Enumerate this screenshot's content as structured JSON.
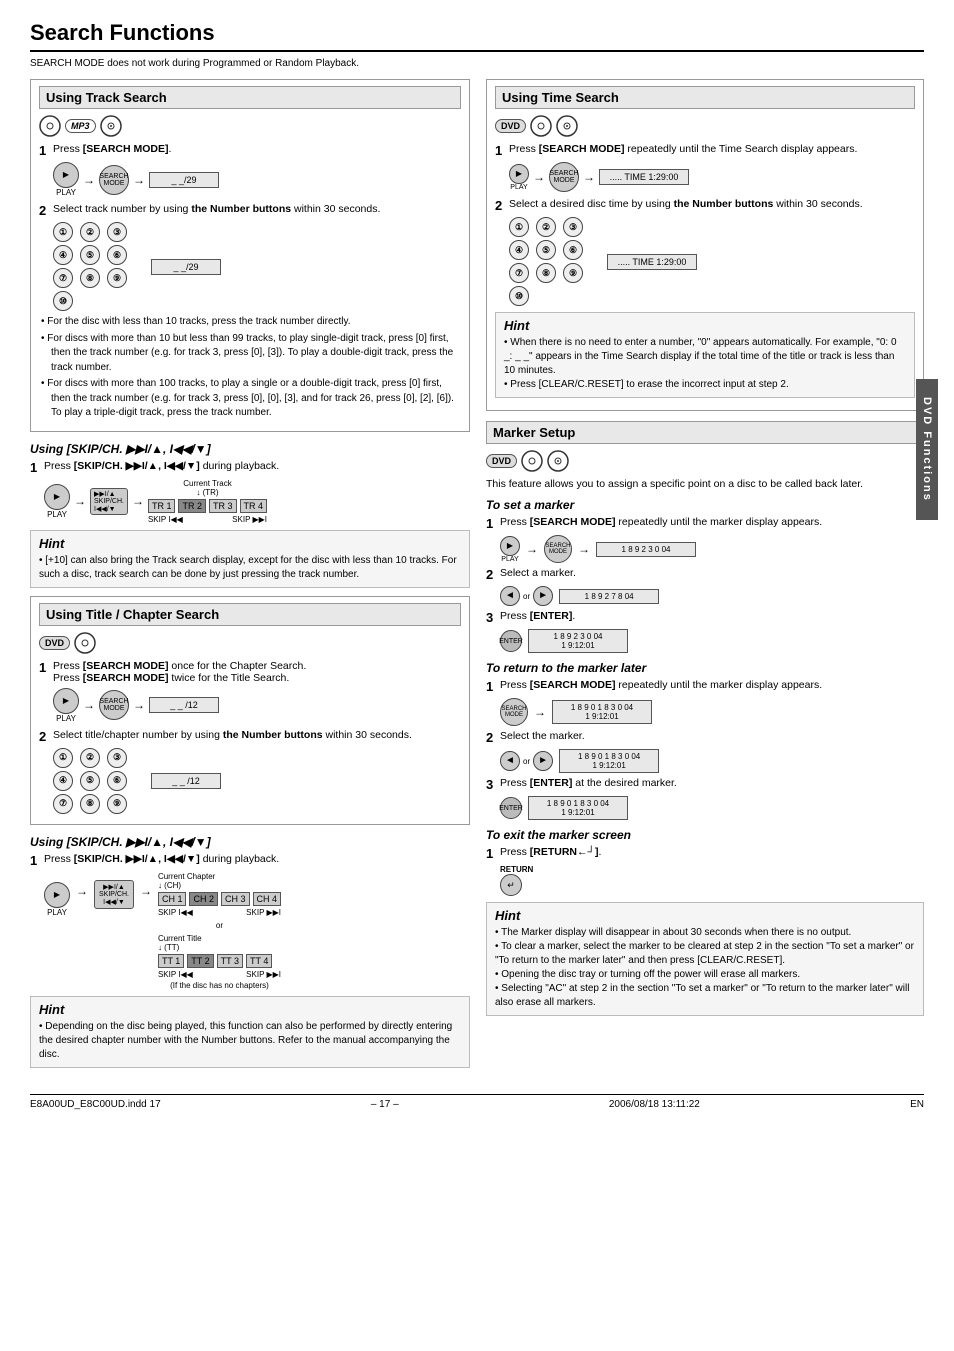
{
  "page": {
    "title": "Search Functions",
    "subtitle": "SEARCH MODE does not work during Programmed or Random Playback.",
    "footer_center": "– 17 –",
    "footer_right": "EN",
    "footer_file": "E8A00UD_E8C00UD.indd  17",
    "footer_date": "2006/08/18  13:11:22"
  },
  "left": {
    "track_search": {
      "title": "Using Track Search",
      "media": [
        "CD",
        "MP3",
        "disc"
      ],
      "step1_label": "1",
      "step1_text": "Press [SEARCH MODE].",
      "step2_label": "2",
      "step2_text": "Select track number by using the Number buttons within 30 seconds.",
      "display1": "_ _/29",
      "display2": "_ _/29",
      "bullets": [
        "For the disc with less than 10 tracks, press the track number directly.",
        "For discs with more than 10 but less than 99 tracks, to play single-digit track, press [0] first, then the track number (e.g. for track 3, press [0], [3]). To play a double-digit track, press the track number.",
        "For discs with more than 100 tracks, to play a single or a double-digit track, press [0] first, then the track number (e.g. for track 3, press [0], [0], [3], and for track 26, press [0], [2], [6]). To play a triple-digit track, press the track number."
      ]
    },
    "skip_search1": {
      "title": "Using [SKIP/CH. ▶▶I/▲, I◀◀/▼]",
      "step1_label": "1",
      "step1_text": "Press [SKIP/CH. ▶▶I/▲, I◀◀/▼] during playback.",
      "tracks": [
        "TR 1",
        "TR 2",
        "TR 3",
        "TR 4"
      ],
      "active_track": "TR 2",
      "current_track_label": "Current Track",
      "tr_label": "(TR)",
      "skip_back": "SKIP I◀◀",
      "skip_fwd": "SKIP ▶▶I",
      "hint": {
        "title": "Hint",
        "bullets": [
          "[+10] can also bring the Track search display, except for the disc with less than 10 tracks. For such a disc, track search can be done by just pressing the track number."
        ]
      }
    },
    "title_chapter_search": {
      "title": "Using Title / Chapter Search",
      "media": [
        "DVD",
        "disc"
      ],
      "step1_label": "1",
      "step1_text1": "Press [SEARCH MODE] once for the Chapter Search.",
      "step1_text2": "Press [SEARCH MODE] twice for the Title Search.",
      "display1": "_ _ /12",
      "step2_label": "2",
      "step2_text": "Select title/chapter number by using the Number buttons within 30 seconds.",
      "display2": "_ _ /12"
    },
    "skip_search2": {
      "title": "Using [SKIP/CH. ▶▶I/▲, I◀◀/▼]",
      "step1_label": "1",
      "step1_text": "Press [SKIP/CH. ▶▶I/▲, I◀◀/▼] during playback.",
      "current_chapter": "Current Chapter",
      "ch_label": "(CH)",
      "chapters": [
        "CH 1",
        "CH 2",
        "CH 3",
        "CH 4"
      ],
      "skip_back": "SKIP I◀◀",
      "skip_fwd": "SKIP ▶▶I",
      "or_label": "or",
      "current_title": "Current Title",
      "tt_label": "(TT)",
      "titles": [
        "TT 1",
        "TT 2",
        "TT 3",
        "TT 4"
      ],
      "no_chapters_note": "(If the disc has no chapters)",
      "hint": {
        "title": "Hint",
        "bullets": [
          "Depending on the disc being played, this function can also be performed by directly entering the desired chapter number with the Number buttons. Refer to the manual accompanying the disc."
        ]
      }
    }
  },
  "right": {
    "time_search": {
      "title": "Using Time Search",
      "media": [
        "DVD",
        "CD",
        "disc"
      ],
      "step1_label": "1",
      "step1_text": "Press [SEARCH MODE] repeatedly until the Time Search display appears.",
      "display1": "..... TIME 1:29:00",
      "step2_label": "2",
      "step2_text": "Select a desired disc time by using the Number buttons within 30 seconds.",
      "display2": "..... TIME 1:29:00",
      "hint": {
        "title": "Hint",
        "bullets": [
          "When there is no need to enter a number, \"0\" appears automatically. For example, \"0: 0 _: _ _\" appears in the Time Search display if the total time of the title or track is less than 10 minutes.",
          "Press [CLEAR/C.RESET] to erase the incorrect input at step 2."
        ]
      }
    },
    "marker_setup": {
      "title": "Marker Setup",
      "media": [
        "DVD",
        "CD",
        "disc"
      ],
      "description": "This feature allows you to assign a specific point on a disc to be called back later.",
      "set_marker": {
        "title": "To set a marker",
        "step1_label": "1",
        "step1_text": "Press [SEARCH MODE] repeatedly until the marker display appears.",
        "display1": "1 8 9 2 3 0 04",
        "step2_label": "2",
        "step2_text": "Select a marker.",
        "display2": "1 8 9 2 7 8 04",
        "step3_label": "3",
        "step3_text": "Press [ENTER].",
        "display3": "1 8 9 2 3 0 04\n1 9:12:01"
      },
      "return_marker": {
        "title": "To return to the marker later",
        "step1_label": "1",
        "step1_text": "Press [SEARCH MODE] repeatedly until the marker display appears.",
        "display1": "1 8 9 0 1 8 3 0 04\n1 9:12:01",
        "step2_label": "2",
        "step2_text": "Select the marker.",
        "display2": "1 8 9 0 1 8 3 0 04\n1 9:12:01",
        "step3_label": "3",
        "step3_text": "Press [ENTER] at the desired marker.",
        "display3": "1 8 9 0 1 8 3 0 04\n1 9:12:01"
      },
      "exit_marker": {
        "title": "To exit the marker screen",
        "step1_label": "1",
        "step1_text": "Press [RETURN←┘].",
        "return_label": "RETURN\n←┘"
      },
      "hint": {
        "title": "Hint",
        "bullets": [
          "The Marker display will disappear in about 30 seconds when there is no output.",
          "To clear a marker, select the marker to be cleared at step 2 in the section \"To set a marker\" or \"To return to the marker later\" and then press [CLEAR/C.RESET].",
          "Opening the disc tray or turning off the power will erase all markers.",
          "Selecting \"AC\" at step 2 in the section \"To set a marker\" or \"To return to the marker later\" will also erase all markers."
        ]
      }
    },
    "dvd_functions_label": "DVD Functions"
  }
}
